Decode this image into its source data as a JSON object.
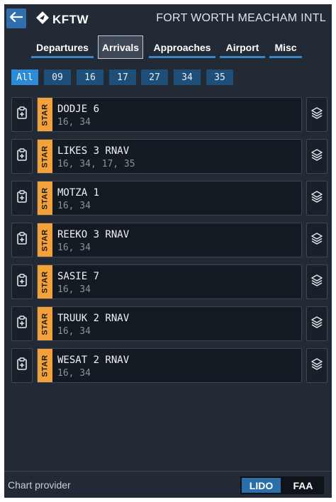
{
  "header": {
    "back_icon": "arrow-left-icon",
    "logo_icon": "navigraph-logo-icon",
    "icao": "KFTW",
    "airport_name": "FORT WORTH MEACHAM INTL"
  },
  "tabs": [
    {
      "label": "Departures",
      "active": false
    },
    {
      "label": "Arrivals",
      "active": true
    },
    {
      "label": "Approaches",
      "active": false
    },
    {
      "label": "Airport",
      "active": false
    },
    {
      "label": "Misc",
      "active": false
    }
  ],
  "runway_filters": [
    {
      "label": "All",
      "active": true
    },
    {
      "label": "09",
      "active": false
    },
    {
      "label": "16",
      "active": false
    },
    {
      "label": "17",
      "active": false
    },
    {
      "label": "27",
      "active": false
    },
    {
      "label": "34",
      "active": false
    },
    {
      "label": "35",
      "active": false
    }
  ],
  "procedures": [
    {
      "type": "STAR",
      "name": "DODJE 6",
      "runways": "16, 34"
    },
    {
      "type": "STAR",
      "name": "LIKES 3 RNAV",
      "runways": "16, 34, 17, 35"
    },
    {
      "type": "STAR",
      "name": "MOTZA 1",
      "runways": "16, 34"
    },
    {
      "type": "STAR",
      "name": "REEKO 3 RNAV",
      "runways": "16, 34"
    },
    {
      "type": "STAR",
      "name": "SASIE 7",
      "runways": "16, 34"
    },
    {
      "type": "STAR",
      "name": "TRUUK 2 RNAV",
      "runways": "16, 34"
    },
    {
      "type": "STAR",
      "name": "WESAT 2 RNAV",
      "runways": "16, 34"
    }
  ],
  "icons": {
    "row_left": "clipboard-plus-icon",
    "row_right": "layers-icon"
  },
  "footer": {
    "label": "Chart provider",
    "providers": [
      {
        "label": "LIDO",
        "active": true
      },
      {
        "label": "FAA",
        "active": false
      }
    ]
  },
  "colors": {
    "background": "#222a36",
    "accent": "#2c8ad6",
    "star_tag": "#f3a13b"
  }
}
